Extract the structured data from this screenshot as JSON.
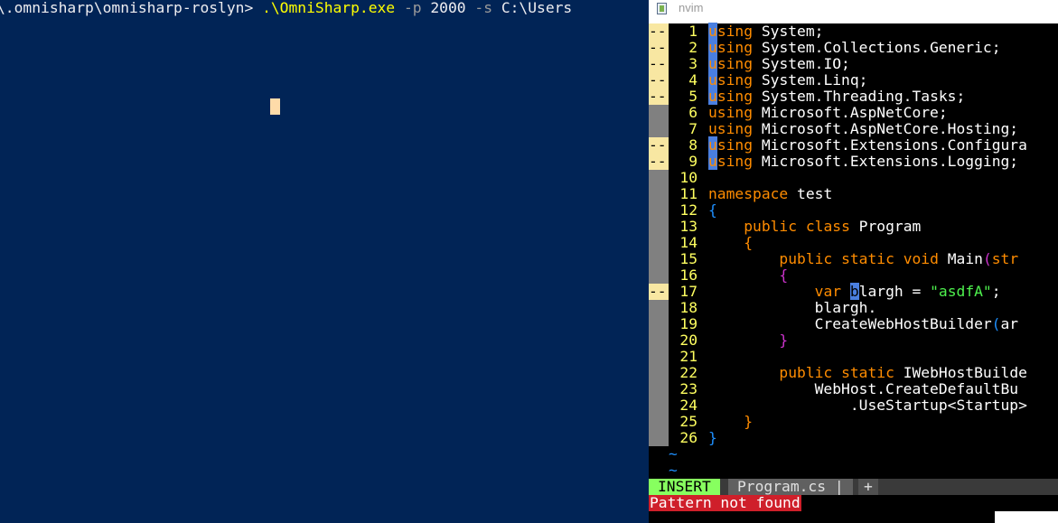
{
  "powershell": {
    "prompt": "\\.omnisharp\\omnisharp-roslyn> ",
    "command": ".\\OmniSharp.exe",
    "arg1_flag": "-p",
    "arg1_value": "2000",
    "arg2_flag": "-s",
    "arg2_value": "C:\\Users"
  },
  "nvim": {
    "window_title": "nvim",
    "icon": "app-icon",
    "lines": [
      {
        "n": "1",
        "sign": "--",
        "code": [
          {
            "t": "u",
            "c": "hl"
          },
          {
            "t": "sing",
            "c": "kw"
          },
          {
            "t": " System;",
            "c": ""
          }
        ]
      },
      {
        "n": "2",
        "sign": "--",
        "code": [
          {
            "t": "u",
            "c": "hl"
          },
          {
            "t": "sing",
            "c": "kw"
          },
          {
            "t": " System.Collections.Generic;",
            "c": ""
          }
        ]
      },
      {
        "n": "3",
        "sign": "--",
        "code": [
          {
            "t": "u",
            "c": "hl"
          },
          {
            "t": "sing",
            "c": "kw"
          },
          {
            "t": " System.IO;",
            "c": ""
          }
        ]
      },
      {
        "n": "4",
        "sign": "--",
        "code": [
          {
            "t": "u",
            "c": "hl"
          },
          {
            "t": "sing",
            "c": "kw"
          },
          {
            "t": " System.Linq;",
            "c": ""
          }
        ]
      },
      {
        "n": "5",
        "sign": "--",
        "code": [
          {
            "t": "u",
            "c": "hl"
          },
          {
            "t": "sing",
            "c": "kw"
          },
          {
            "t": " System.Threading.Tasks;",
            "c": ""
          }
        ]
      },
      {
        "n": "6",
        "sign": "",
        "code": [
          {
            "t": "using",
            "c": "kw"
          },
          {
            "t": " Microsoft.AspNetCore;",
            "c": ""
          }
        ]
      },
      {
        "n": "7",
        "sign": "",
        "code": [
          {
            "t": "using",
            "c": "kw"
          },
          {
            "t": " Microsoft.AspNetCore.Hosting;",
            "c": ""
          }
        ]
      },
      {
        "n": "8",
        "sign": "--",
        "code": [
          {
            "t": "u",
            "c": "hl"
          },
          {
            "t": "sing",
            "c": "kw"
          },
          {
            "t": " Microsoft.Extensions.Configura",
            "c": ""
          }
        ]
      },
      {
        "n": "9",
        "sign": "--",
        "code": [
          {
            "t": "u",
            "c": "hl"
          },
          {
            "t": "sing",
            "c": "kw"
          },
          {
            "t": " Microsoft.Extensions.Logging;",
            "c": ""
          }
        ]
      },
      {
        "n": "10",
        "sign": "",
        "code": []
      },
      {
        "n": "11",
        "sign": "",
        "code": [
          {
            "t": "namespace",
            "c": "kw"
          },
          {
            "t": " test",
            "c": ""
          }
        ]
      },
      {
        "n": "12",
        "sign": "",
        "code": [
          {
            "t": "{",
            "c": "brace"
          }
        ]
      },
      {
        "n": "13",
        "sign": "",
        "code": [
          {
            "t": "    ",
            "c": ""
          },
          {
            "t": "public",
            "c": "kw"
          },
          {
            "t": " ",
            "c": ""
          },
          {
            "t": "class",
            "c": "kw"
          },
          {
            "t": " Program",
            "c": ""
          }
        ]
      },
      {
        "n": "14",
        "sign": "",
        "code": [
          {
            "t": "    ",
            "c": ""
          },
          {
            "t": "{",
            "c": "kw"
          }
        ]
      },
      {
        "n": "15",
        "sign": "",
        "code": [
          {
            "t": "        ",
            "c": ""
          },
          {
            "t": "public",
            "c": "kw"
          },
          {
            "t": " ",
            "c": ""
          },
          {
            "t": "static",
            "c": "kw"
          },
          {
            "t": " ",
            "c": ""
          },
          {
            "t": "void",
            "c": "kw"
          },
          {
            "t": " Main",
            "c": ""
          },
          {
            "t": "(",
            "c": "brace2"
          },
          {
            "t": "str",
            "c": "kw"
          }
        ]
      },
      {
        "n": "16",
        "sign": "",
        "code": [
          {
            "t": "        ",
            "c": ""
          },
          {
            "t": "{",
            "c": "brace2"
          }
        ]
      },
      {
        "n": "17",
        "sign": "--",
        "code": [
          {
            "t": "            ",
            "c": ""
          },
          {
            "t": "var",
            "c": "kw"
          },
          {
            "t": " ",
            "c": ""
          },
          {
            "t": "b",
            "c": "hlw"
          },
          {
            "t": "largh = ",
            "c": ""
          },
          {
            "t": "\"asdfA\"",
            "c": "str"
          },
          {
            "t": ";",
            "c": ""
          }
        ]
      },
      {
        "n": "18",
        "sign": "",
        "code": [
          {
            "t": "            blargh.",
            "c": ""
          }
        ]
      },
      {
        "n": "19",
        "sign": "",
        "code": [
          {
            "t": "            CreateWebHostBuilder",
            "c": ""
          },
          {
            "t": "(",
            "c": "brace"
          },
          {
            "t": "ar",
            "c": ""
          }
        ]
      },
      {
        "n": "20",
        "sign": "",
        "code": [
          {
            "t": "        ",
            "c": ""
          },
          {
            "t": "}",
            "c": "brace2"
          }
        ]
      },
      {
        "n": "21",
        "sign": "",
        "code": []
      },
      {
        "n": "22",
        "sign": "",
        "code": [
          {
            "t": "        ",
            "c": ""
          },
          {
            "t": "public",
            "c": "kw"
          },
          {
            "t": " ",
            "c": ""
          },
          {
            "t": "static",
            "c": "kw"
          },
          {
            "t": " IWebHostBuilde",
            "c": ""
          }
        ]
      },
      {
        "n": "23",
        "sign": "",
        "code": [
          {
            "t": "            WebHost.CreateDefaultBu",
            "c": ""
          }
        ]
      },
      {
        "n": "24",
        "sign": "",
        "code": [
          {
            "t": "                .UseStartup<Startup>",
            "c": ""
          }
        ]
      },
      {
        "n": "25",
        "sign": "",
        "code": [
          {
            "t": "    ",
            "c": ""
          },
          {
            "t": "}",
            "c": "kw"
          }
        ]
      },
      {
        "n": "26",
        "sign": "",
        "code": [
          {
            "t": "}",
            "c": "brace"
          }
        ]
      }
    ],
    "tildes": [
      "~",
      "~"
    ],
    "status": {
      "mode": "INSERT",
      "file": "Program.cs",
      "sep": "|",
      "plus": "+"
    },
    "message": "Pattern not found"
  }
}
